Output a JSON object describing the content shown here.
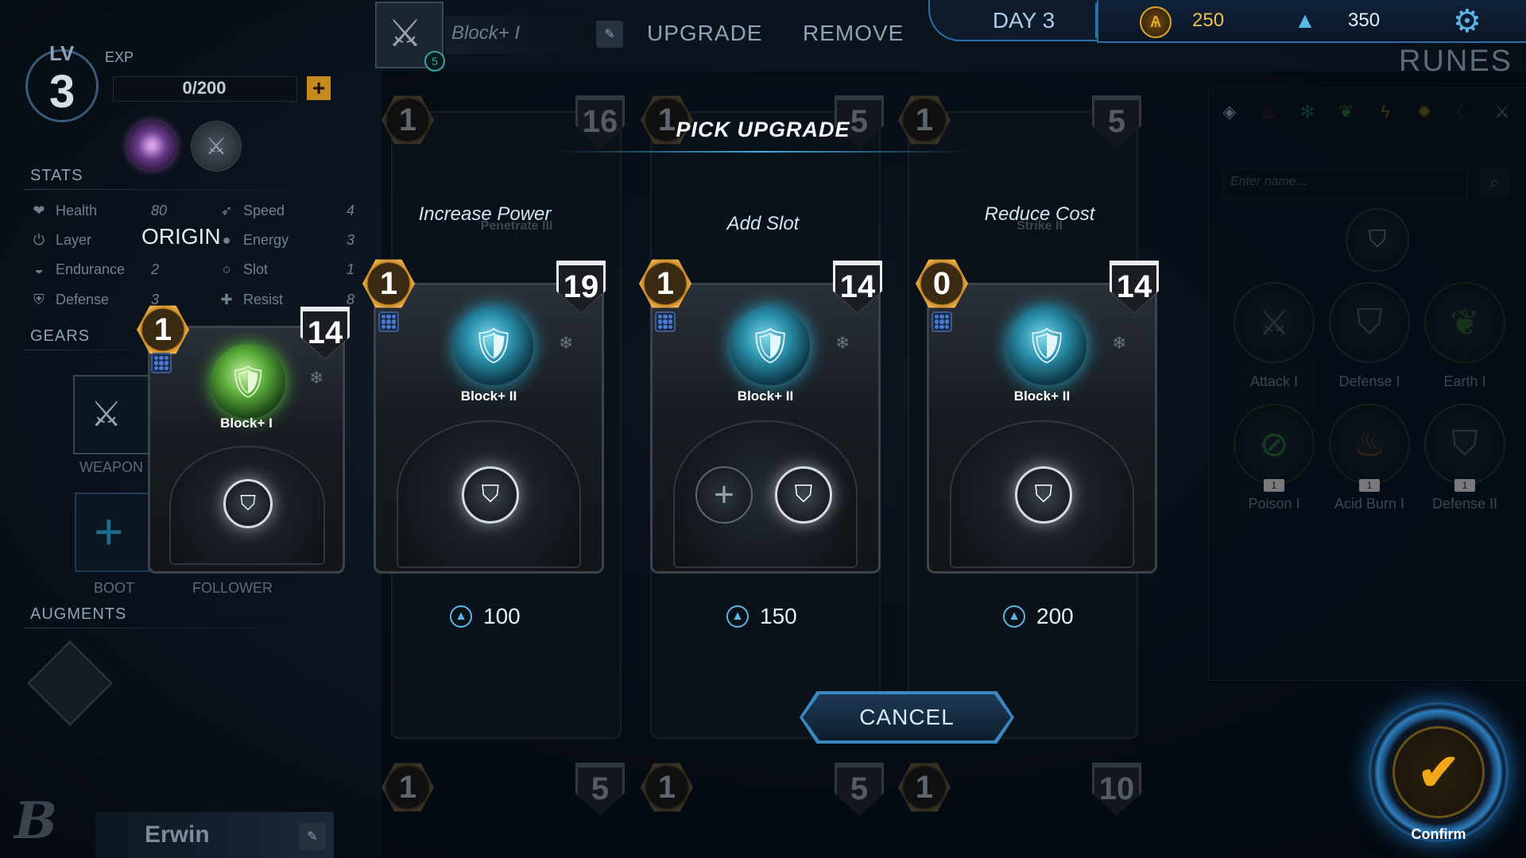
{
  "player": {
    "lv_label": "LV",
    "level": "3",
    "exp_label": "EXP",
    "exp": "0/200",
    "name": "Erwin"
  },
  "stats": {
    "title": "STATS",
    "left": [
      {
        "label": "Health",
        "value": "80",
        "icon": "heart-icon"
      },
      {
        "label": "Layer",
        "value": "",
        "icon": "power-icon"
      },
      {
        "label": "Endurance",
        "value": "2",
        "icon": "endurance-icon"
      },
      {
        "label": "Defense",
        "value": "3",
        "icon": "shield-icon"
      }
    ],
    "right": [
      {
        "label": "Speed",
        "value": "4",
        "icon": "speed-icon"
      },
      {
        "label": "Energy",
        "value": "3",
        "icon": "energy-icon"
      },
      {
        "label": "Slot",
        "value": "1",
        "icon": "slot-icon"
      },
      {
        "label": "Resist",
        "value": "8",
        "icon": "resist-icon"
      }
    ],
    "origin": "ORIGIN"
  },
  "gears": {
    "title": "GEARS",
    "weapon_label": "WEAPON",
    "weapon_level": "5",
    "boot_label": "BOOT",
    "follower_label": "FOLLOWER"
  },
  "augments": {
    "title": "AUGMENTS"
  },
  "selected_card": {
    "name": "Block+ I",
    "cost": "1",
    "power": "14"
  },
  "topbar": {
    "card_name": "Block+ I",
    "card_level": "5",
    "upgrade_label": "UPGRADE",
    "remove_label": "REMOVE",
    "day": "DAY 3",
    "gold": "250",
    "crystals": "350"
  },
  "runes": {
    "title": "RUNES",
    "search_placeholder": "Enter name...",
    "filters": [
      "diamond-icon",
      "fire-icon",
      "snowflake-icon",
      "leaf-icon",
      "lightning-icon",
      "sun-icon",
      "moon-icon",
      "sword-icon"
    ],
    "items": [
      {
        "label": "Attack I",
        "icon": "sword-icon"
      },
      {
        "label": "Defense I",
        "icon": "shield-icon"
      },
      {
        "label": "Earth I",
        "icon": "leaf-icon"
      },
      {
        "label": "Poison I",
        "icon": "poison-icon",
        "count": "1"
      },
      {
        "label": "Acid Burn I",
        "icon": "flame-icon",
        "count": "1"
      },
      {
        "label": "Defense II",
        "icon": "shield-icon",
        "count": "1"
      }
    ]
  },
  "modal": {
    "title": "PICK UPGRADE",
    "cancel_label": "CANCEL",
    "options": [
      {
        "label": "Increase Power",
        "card_name": "Block+ II",
        "cost": "1",
        "power": "19",
        "price": "100"
      },
      {
        "label": "Add Slot",
        "card_name": "Block+ II",
        "cost": "1",
        "power": "14",
        "price": "150"
      },
      {
        "label": "Reduce Cost",
        "card_name": "Block+ II",
        "cost": "0",
        "power": "14",
        "price": "200"
      }
    ]
  },
  "background_cards": {
    "top": [
      {
        "cost": "1",
        "power": "16",
        "name": "Penetrate III"
      },
      {
        "cost": "1",
        "power": "5",
        "name": ""
      },
      {
        "cost": "1",
        "power": "5",
        "name": "Strike II"
      }
    ],
    "bottom": [
      {
        "cost": "1",
        "power": "5"
      },
      {
        "cost": "1",
        "power": "5"
      },
      {
        "cost": "1",
        "power": "10"
      }
    ]
  },
  "confirm_label": "Confirm",
  "colors": {
    "accent": "#3a88c2",
    "gold": "#e2a52a",
    "cyan": "#5ab6e4"
  }
}
